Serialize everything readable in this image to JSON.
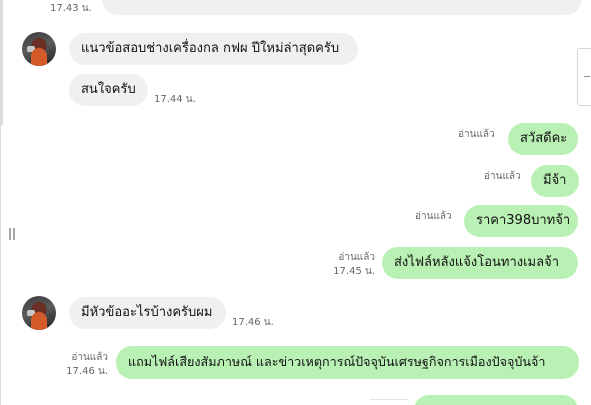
{
  "colors": {
    "incoming_bubble": "#f0f0f0",
    "outgoing_bubble": "#b9f0b4",
    "meta_text": "#666666"
  },
  "messages": [
    {
      "id": "m0",
      "direction": "incoming",
      "time": "17.43 น.",
      "partial": true
    },
    {
      "id": "m1",
      "direction": "incoming",
      "text": "แนวข้อสอบช่างเครื่องกล กฟผ  ปีใหม่ล่าสุดครับ",
      "avatar": "profile-photo"
    },
    {
      "id": "m2",
      "direction": "incoming",
      "text": "สนใจครับ",
      "time": "17.44 น."
    },
    {
      "id": "m3",
      "direction": "outgoing",
      "text": "สวัสดีคะ",
      "read": "อ่านแล้ว"
    },
    {
      "id": "m4",
      "direction": "outgoing",
      "text": "มีจ้า",
      "read": "อ่านแล้ว"
    },
    {
      "id": "m5",
      "direction": "outgoing",
      "text": "ราคา398บาทจ้า",
      "read": "อ่านแล้ว"
    },
    {
      "id": "m6",
      "direction": "outgoing",
      "text": "ส่งไฟล์หลังแจ้งโอนทางเมลจ้า",
      "read": "อ่านแล้ว",
      "time": "17.45 น."
    },
    {
      "id": "m7",
      "direction": "incoming",
      "text": "มีหัวข้ออะไรบ้างครับผม",
      "time": "17.46 น.",
      "avatar": "profile-photo"
    },
    {
      "id": "m8",
      "direction": "outgoing",
      "text": "แถมไฟล์เสียงสัมภาษณ์ และข่าวเหตุการณ์ปัจจุบันเศรษฐกิจการเมืองปัจจุบันจ้า",
      "read": "อ่านแล้ว",
      "time": "17.46 น."
    },
    {
      "id": "m9",
      "direction": "outgoing",
      "partial": true
    }
  ]
}
